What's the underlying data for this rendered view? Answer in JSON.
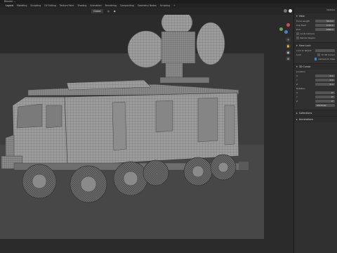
{
  "window": {
    "title": "Blender — "
  },
  "menubar": {
    "tabs": [
      "Layout",
      "Modeling",
      "Sculpting",
      "UV Editing",
      "Texture Paint",
      "Shading",
      "Animation",
      "Rendering",
      "Compositing",
      "Geometry Nodes",
      "Scripting"
    ],
    "active_index": 0
  },
  "toolbar": {
    "global_label": "Global",
    "view_label": "View"
  },
  "shading_modes": [
    "wireframe",
    "solid",
    "material",
    "rendered"
  ],
  "shading_active": 1,
  "sidebar": {
    "options_label": "Options",
    "view_panel": {
      "title": "View",
      "focal_label": "Focal Length",
      "focal_value": "50 mm",
      "clip_start_label": "Clip Start",
      "clip_start_value": "0.01 m",
      "clip_end_label": "End",
      "clip_end_value": "1000 m",
      "local_camera_label": "Local Camera",
      "render_region_label": "Render Region"
    },
    "view_lock": {
      "title": "View Lock",
      "lock_object_label": "Lock to Object",
      "lock_label": "Lock",
      "to_3d_cursor_label": "To 3D Cursor",
      "camera_to_view_label": "Camera to View"
    },
    "cursor_panel": {
      "title": "3D Cursor",
      "location_label": "Location",
      "loc": [
        {
          "axis": "X",
          "value": "0 m"
        },
        {
          "axis": "Y",
          "value": "0 m"
        },
        {
          "axis": "Z",
          "value": "0 m"
        }
      ],
      "rotation_label": "Rotation",
      "rot": [
        {
          "axis": "X",
          "value": "0°"
        },
        {
          "axis": "Y",
          "value": "0°"
        },
        {
          "axis": "Z",
          "value": "0°"
        }
      ],
      "mode_value": "XYZ Euler"
    },
    "collapsed": [
      "Collections",
      "Annotations"
    ]
  },
  "colors": {
    "accent": "#4a80c8",
    "viewport_bg": "#2b2b2b",
    "render_region": "#3e3e3e"
  }
}
